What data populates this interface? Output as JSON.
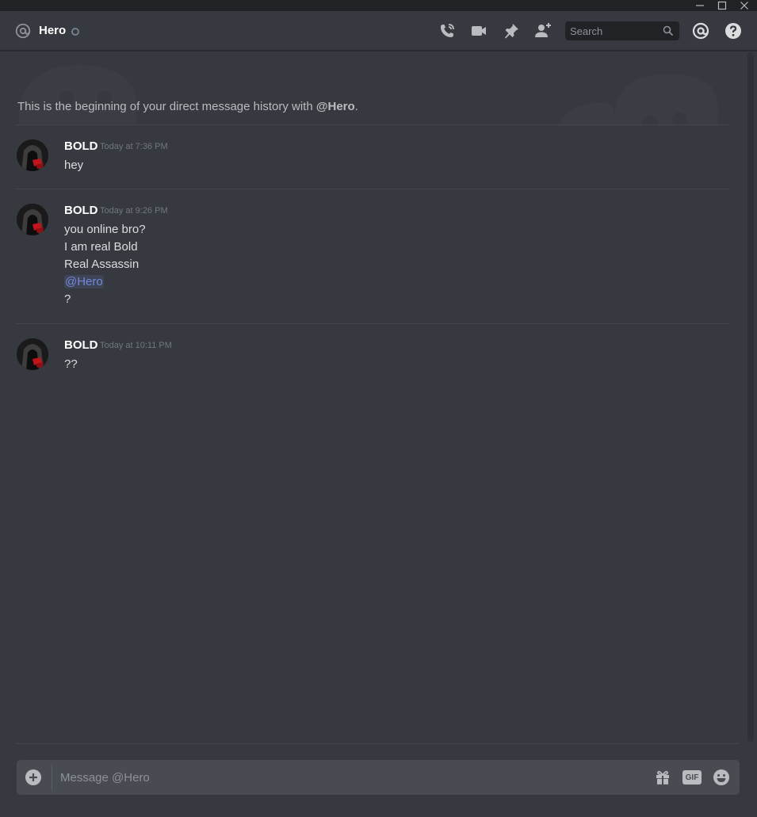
{
  "window": {
    "controls": [
      {
        "icon": "minimize-icon"
      },
      {
        "icon": "maximize-icon"
      },
      {
        "icon": "close-icon"
      }
    ]
  },
  "header": {
    "channel_icon": "at-sign-icon",
    "channel_name": "Hero",
    "status": "offline",
    "actions": [
      {
        "icon": "voice-call-icon"
      },
      {
        "icon": "video-call-icon"
      },
      {
        "icon": "pin-icon"
      },
      {
        "icon": "add-friend-icon"
      }
    ],
    "search": {
      "placeholder": "Search",
      "icon": "search-icon"
    },
    "mentions_icon": "mentions-icon",
    "help_icon": "help-icon"
  },
  "chat": {
    "beginning_prefix": "This is the beginning of your direct message history with ",
    "beginning_user": "@Hero",
    "beginning_suffix": ".",
    "messages": [
      {
        "author": "BOLD",
        "timestamp": "Today at 7:36 PM",
        "lines": [
          "hey"
        ]
      },
      {
        "author": "BOLD",
        "timestamp": "Today at 9:26 PM",
        "lines": [
          "you online bro?",
          "I am real Bold",
          "Real Assassin",
          "@Hero",
          "?"
        ],
        "mention_line_index": 3
      },
      {
        "author": "BOLD",
        "timestamp": "Today at 10:11 PM",
        "lines": [
          "??"
        ]
      }
    ]
  },
  "composer": {
    "placeholder": "Message @Hero",
    "gif_label": "GIF",
    "icons": [
      "add-attachment-icon",
      "gift-icon",
      "gif-icon",
      "emoji-icon"
    ]
  },
  "colors": {
    "background": "#36393f",
    "titlebar": "#202225",
    "mention": "#7289da",
    "username": "#ffffff",
    "timestamp": "#72767d"
  }
}
